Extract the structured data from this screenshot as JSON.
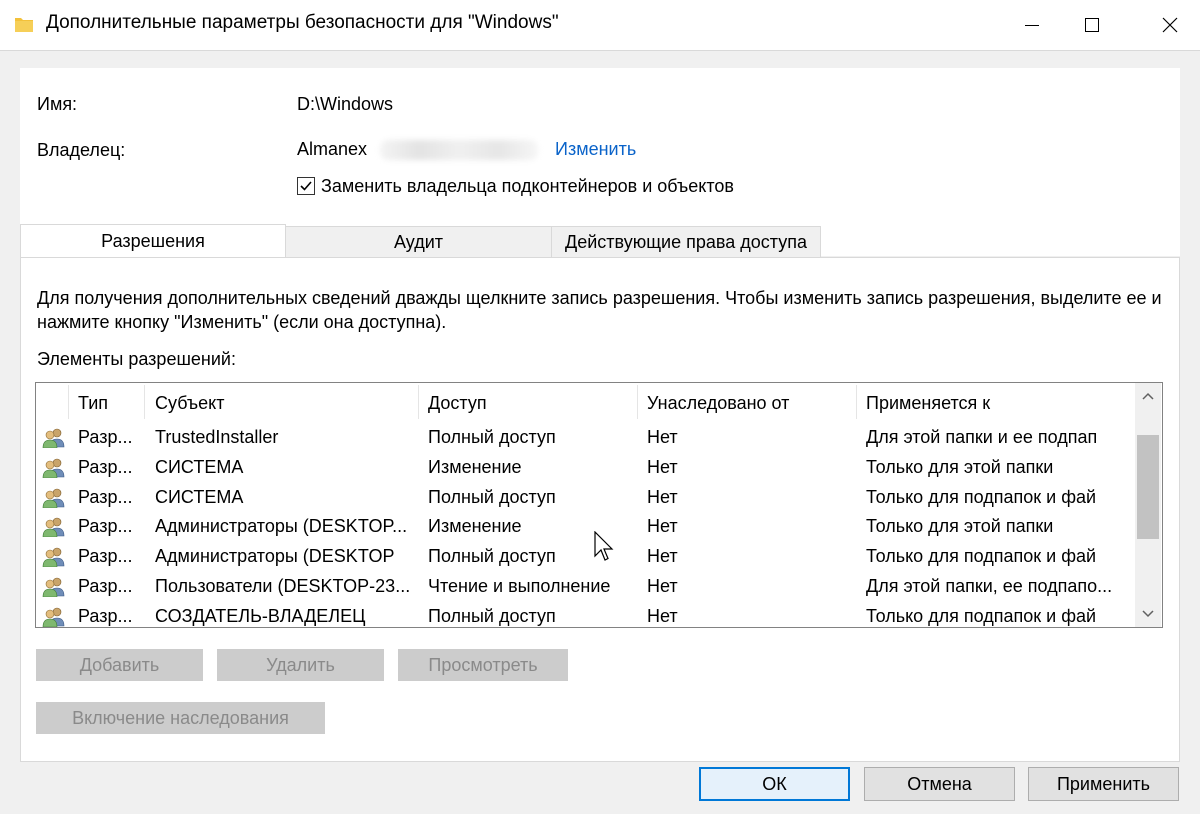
{
  "window": {
    "title": "Дополнительные параметры безопасности  для \"Windows\""
  },
  "info": {
    "name_label": "Имя:",
    "name_value": "D:\\Windows",
    "owner_label": "Владелец:",
    "owner_value": "Almanex",
    "change_link": "Изменить",
    "replace_owner_label": "Заменить владельца подконтейнеров и объектов",
    "replace_owner_checked": true
  },
  "tabs": [
    {
      "label": "Разрешения",
      "active": true
    },
    {
      "label": "Аудит",
      "active": false
    },
    {
      "label": "Действующие права доступа",
      "active": false
    }
  ],
  "permissions": {
    "description": "Для получения дополнительных сведений дважды щелкните запись разрешения. Чтобы изменить запись разрешения, выделите ее и нажмите кнопку \"Изменить\" (если она доступна).",
    "entries_label": "Элементы разрешений:",
    "columns": [
      "Тип",
      "Субъект",
      "Доступ",
      "Унаследовано от",
      "Применяется к"
    ],
    "rows": [
      {
        "type": "Разр...",
        "principal": "TrustedInstaller",
        "access": "Полный доступ",
        "inherited": "Нет",
        "applies": "Для этой папки и ее подпап"
      },
      {
        "type": "Разр...",
        "principal": "СИСТЕМА",
        "access": "Изменение",
        "inherited": "Нет",
        "applies": "Только для этой папки"
      },
      {
        "type": "Разр...",
        "principal": "СИСТЕМА",
        "access": "Полный доступ",
        "inherited": "Нет",
        "applies": "Только для подпапок и фай"
      },
      {
        "type": "Разр...",
        "principal": "Администраторы (DESKTOP...",
        "access": "Изменение",
        "inherited": "Нет",
        "applies": "Только для этой папки"
      },
      {
        "type": "Разр...",
        "principal": "Администраторы (DESKTOP",
        "access": "Полный доступ",
        "inherited": "Нет",
        "applies": "Только для подпапок и фай"
      },
      {
        "type": "Разр...",
        "principal": "Пользователи (DESKTOP-23...",
        "access": "Чтение и выполнение",
        "inherited": "Нет",
        "applies": "Для этой папки, ее подпапо..."
      },
      {
        "type": "Разр...",
        "principal": "СОЗДАТЕЛЬ-ВЛАДЕЛЕЦ",
        "access": "Полный доступ",
        "inherited": "Нет",
        "applies": "Только для подпапок и фай"
      }
    ],
    "row_icon": "users-icon"
  },
  "actions": {
    "add": "Добавить",
    "remove": "Удалить",
    "view": "Просмотреть",
    "inheritance": "Включение наследования"
  },
  "footer": {
    "ok": "ОК",
    "cancel": "Отмена",
    "apply": "Применить"
  },
  "colors": {
    "link": "#0a63c9",
    "accent": "#0078d7",
    "folder": "#f3c13a"
  }
}
